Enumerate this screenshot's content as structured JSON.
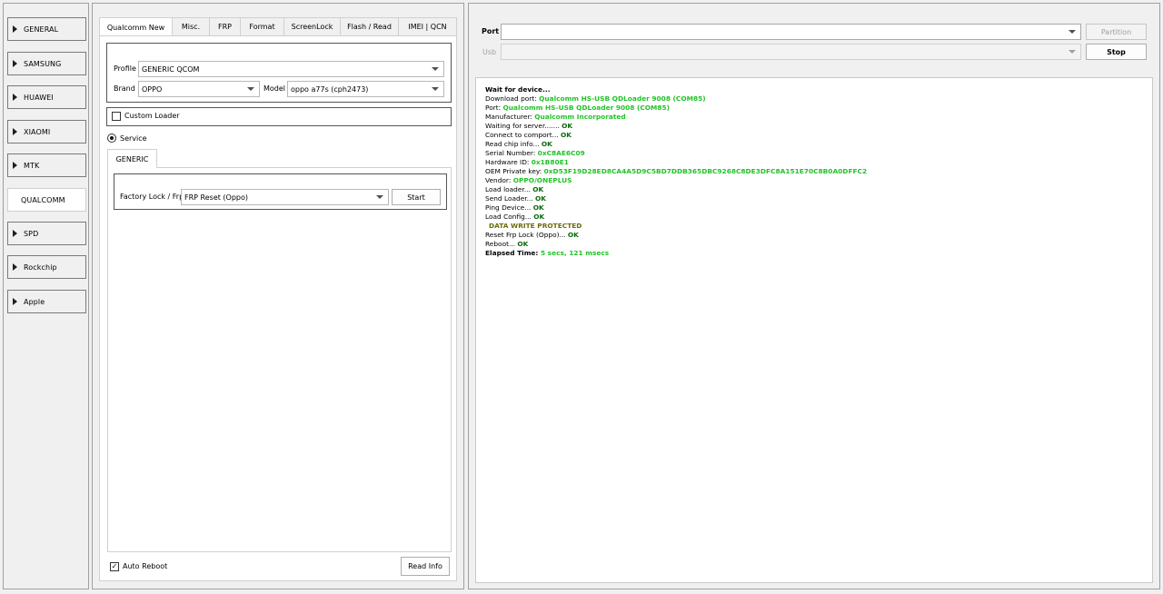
{
  "nav": {
    "items": [
      {
        "label": "GENERAL",
        "active": false
      },
      {
        "label": "SAMSUNG",
        "active": false
      },
      {
        "label": "HUAWEI",
        "active": false
      },
      {
        "label": "XIAOMI",
        "active": false
      },
      {
        "label": "MTK",
        "active": false
      },
      {
        "label": "QUALCOMM",
        "active": true
      },
      {
        "label": "SPD",
        "active": false
      },
      {
        "label": "Rockchip",
        "active": false
      },
      {
        "label": "Apple",
        "active": false
      }
    ]
  },
  "tabs": [
    {
      "label": "Qualcomm New",
      "active": true
    },
    {
      "label": "Misc.",
      "active": false
    },
    {
      "label": "FRP",
      "active": false
    },
    {
      "label": "Format",
      "active": false
    },
    {
      "label": "ScreenLock",
      "active": false
    },
    {
      "label": "Flash / Read",
      "active": false
    },
    {
      "label": "IMEI | QCN",
      "active": false
    }
  ],
  "device": {
    "profile_label": "Profile",
    "profile_value": "GENERIC QCOM",
    "brand_label": "Brand",
    "brand_value": "OPPO",
    "model_label": "Model",
    "model_value": "oppo a77s (cph2473)"
  },
  "custom_loader": {
    "label": "Custom Loader",
    "checked": false
  },
  "service": {
    "label": "Service",
    "selected": true
  },
  "subtab": {
    "label": "GENERIC"
  },
  "factory": {
    "label": "Factory Lock / Frp",
    "value": "FRP Reset (Oppo)",
    "start_label": "Start"
  },
  "auto_reboot": {
    "label": "Auto Reboot",
    "checked": true,
    "mark": "✓"
  },
  "read_info_label": "Read Info",
  "port": {
    "label": "Port",
    "value": "",
    "partition_label": "Partition"
  },
  "usb": {
    "label": "Usb",
    "value": "",
    "stop_label": "Stop"
  },
  "log": {
    "l1": "Wait for device...",
    "l2k": "Download port: ",
    "l2v": "Qualcomm HS-USB QDLoader 9008 (COM85)",
    "l3k": "Port: ",
    "l3v": "Qualcomm HS-USB QDLoader 9008 (COM85)",
    "l4k": "Manufacturer: ",
    "l4v": "Qualcomm Incorporated",
    "l5k": "Waiting for server....... ",
    "l5v": "OK",
    "l6k": "Connect to comport... ",
    "l6v": "OK",
    "l7k": "Read chip info... ",
    "l7v": "OK",
    "l8k": "Serial Number: ",
    "l8v": "0xC8AE6C09",
    "l9k": "Hardware ID: ",
    "l9v": "0x1B80E1",
    "l10k": "OEM Private key: ",
    "l10v": "0xD53F19D28ED8CA4A5D9C5BD7DDB365DBC9268C8DE3DFC8A151E70C8B0A0DFFC2",
    "l11k": "Vendor: ",
    "l11v": "OPPO/ONEPLUS",
    "l12k": "Load loader... ",
    "l12v": "OK",
    "l13k": "Send Loader... ",
    "l13v": "OK",
    "l14k": "Ping Device... ",
    "l14v": "OK",
    "l15k": "Load Config... ",
    "l15v": "OK",
    "l16": "DATA WRITE PROTECTED",
    "l17k": "Reset Frp Lock (Oppo)... ",
    "l17v": "OK",
    "l18k": "Reboot... ",
    "l18v": "OK",
    "l19k": "Elapsed Time: ",
    "l19v": "5 secs, 121 msecs"
  },
  "colors": {
    "log_value": "#21c328",
    "log_ok": "#0a6a0a",
    "log_warning": "#6b6b0a"
  }
}
